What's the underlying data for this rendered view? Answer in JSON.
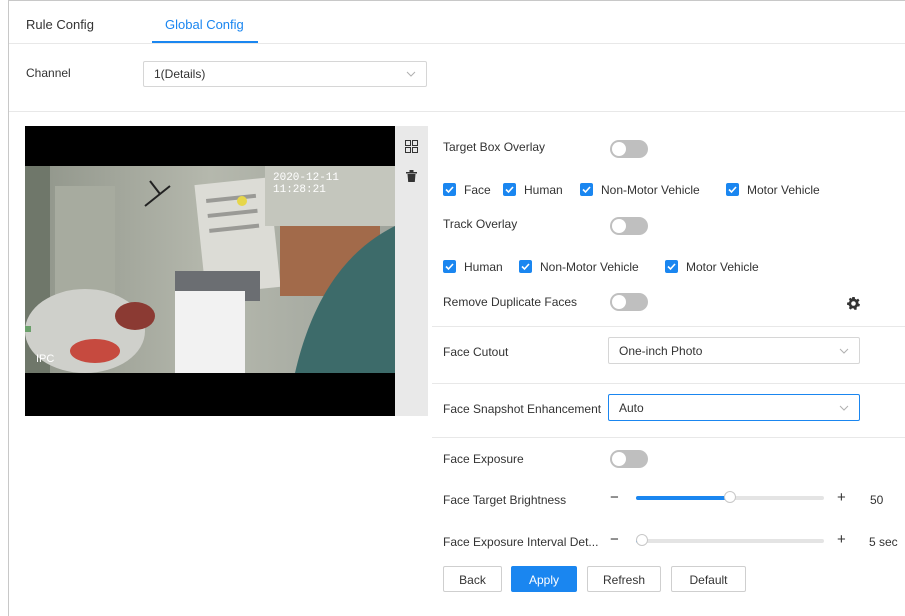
{
  "tabs": [
    {
      "label": "Rule Config",
      "active": false
    },
    {
      "label": "Global Config",
      "active": true
    }
  ],
  "channel": {
    "label": "Channel",
    "value": "1(Details)"
  },
  "video": {
    "timestamp": "2020-12-11 11:28:21",
    "osd_label": "IPC",
    "tool_icons": [
      "grid-icon",
      "trash-icon"
    ]
  },
  "settings": {
    "target_box_overlay": {
      "label": "Target Box Overlay",
      "enabled": false
    },
    "target_types": [
      {
        "label": "Face",
        "checked": true
      },
      {
        "label": "Human",
        "checked": true
      },
      {
        "label": "Non-Motor Vehicle",
        "checked": true
      },
      {
        "label": "Motor Vehicle",
        "checked": true
      }
    ],
    "track_overlay": {
      "label": "Track Overlay",
      "enabled": false
    },
    "track_types": [
      {
        "label": "Human",
        "checked": true
      },
      {
        "label": "Non-Motor Vehicle",
        "checked": true
      },
      {
        "label": "Motor Vehicle",
        "checked": true
      }
    ],
    "remove_duplicate_faces": {
      "label": "Remove Duplicate Faces",
      "enabled": false,
      "settings_icon": "gear-icon"
    },
    "face_cutout": {
      "label": "Face Cutout",
      "value": "One-inch Photo"
    },
    "face_snapshot_enhancement": {
      "label": "Face Snapshot Enhancement",
      "value": "Auto"
    },
    "face_exposure": {
      "label": "Face Exposure",
      "enabled": false
    },
    "face_target_brightness": {
      "label": "Face Target Brightness",
      "value": "50",
      "level": 0.5
    },
    "face_exposure_interval": {
      "label": "Face Exposure Interval Det...",
      "value": "5 sec",
      "level": 0.03
    }
  },
  "buttons": {
    "back": "Back",
    "apply": "Apply",
    "refresh": "Refresh",
    "default": "Default"
  },
  "colors": {
    "accent": "#1a86f0",
    "toggle_off": "#bfbfbf"
  }
}
